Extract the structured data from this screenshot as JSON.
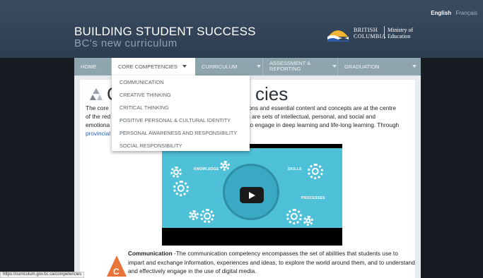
{
  "header": {
    "lang_en": "English",
    "lang_fr": "Français",
    "title_line1": "BUILDING STUDENT SUCCESS",
    "title_line2": "BC's new curriculum",
    "logo_line1": "BRITISH",
    "logo_line2": "COLUMBIA",
    "ministry_line1": "Ministry of",
    "ministry_line2": "Education"
  },
  "nav": {
    "items": [
      {
        "label": "HOME"
      },
      {
        "label": "CORE COMPETENCIES"
      },
      {
        "label": "CURRICULUM"
      },
      {
        "label": "ASSESSMENT &"
      },
      {
        "label": "GRADUATION"
      }
    ],
    "assessment_line2": "REPORTING"
  },
  "dropdown": {
    "items": [
      "COMMUNICATION",
      "CREATIVE THINKING",
      "CRITICAL THINKING",
      "POSITIVE PERSONAL & CULTURAL IDENTITY",
      "PERSONAL AWARENESS AND RESPONSIBILITY",
      "SOCIAL RESPONSIBILITY"
    ]
  },
  "page": {
    "title_start": "C",
    "title_end": "cies",
    "intro_lines": [
      {
        "left": "The core",
        "right": "ations and essential content and concepts are at the centre"
      },
      {
        "left": "of the red",
        "right": "es are sets of intellectual, personal, and social and"
      },
      {
        "left": "emotiona",
        "right": "r to engage in deep learning and life-long learning. Through"
      },
      {
        "left": "provincial",
        "right": ""
      }
    ]
  },
  "video": {
    "label_knowledge": "KNOWLEDGE",
    "label_skills": "SKILLS",
    "label_processes": "PROCESSES"
  },
  "competency": {
    "badge_letter": "C",
    "name": "Communication",
    "line1_rest": " -The communication competency encompasses the set of abilities that students use to",
    "line2": "impart and exchange information, experiences and ideas, to explore the world around them, and to understand",
    "line3": "and effectively engage in the use of digital media."
  },
  "status_url": "https://curriculum.gov.bc.ca/competencies",
  "colors": {
    "header_bg": "#34465a",
    "nav_bg": "#8fa5ad",
    "accent_orange": "#e8743a",
    "video_bg": "#4ec0d8"
  }
}
